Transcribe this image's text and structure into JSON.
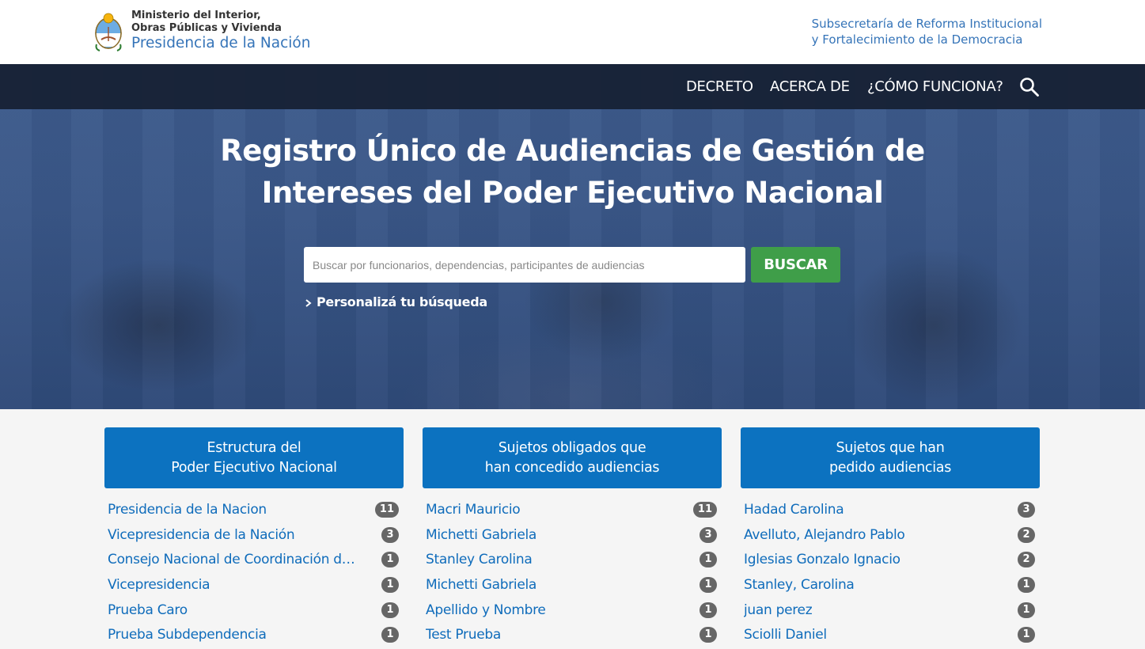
{
  "header": {
    "ministry_line1": "Ministerio del Interior,",
    "ministry_line2": "Obras Públicas y Vivienda",
    "presidency": "Presidencia de la Nación",
    "subsecretary_line1": "Subsecretaría de Reforma Institucional",
    "subsecretary_line2": "y Fortalecimiento de la Democracia"
  },
  "nav": {
    "items": [
      "DECRETO",
      "ACERCA DE",
      "¿CÓMO FUNCIONA?"
    ],
    "search_icon": "search-icon"
  },
  "hero": {
    "title_line1": "Registro Único de Audiencias de Gestión de",
    "title_line2": "Intereses del Poder Ejecutivo Nacional",
    "search_placeholder": "Buscar por funcionarios, dependencias, participantes de audiencias",
    "search_button": "BUSCAR",
    "customize_link": "Personalizá tu búsqueda"
  },
  "columns": [
    {
      "title_line1": "Estructura del",
      "title_line2": "Poder Ejecutivo Nacional",
      "items": [
        {
          "name": "Presidencia de la Nacion",
          "count": "11"
        },
        {
          "name": "Vicepresidencia de la Nación",
          "count": "3"
        },
        {
          "name": "Consejo Nacional de Coordinación de P...",
          "count": "1"
        },
        {
          "name": "Vicepresidencia",
          "count": "1"
        },
        {
          "name": "Prueba Caro",
          "count": "1"
        },
        {
          "name": "Prueba Subdependencia",
          "count": "1"
        }
      ]
    },
    {
      "title_line1": "Sujetos obligados que",
      "title_line2": "han concedido audiencias",
      "items": [
        {
          "name": "Macri Mauricio",
          "count": "11"
        },
        {
          "name": "Michetti Gabriela",
          "count": "3"
        },
        {
          "name": "Stanley Carolina",
          "count": "1"
        },
        {
          "name": "Michetti Gabriela",
          "count": "1"
        },
        {
          "name": "Apellido y Nombre",
          "count": "1"
        },
        {
          "name": "Test Prueba",
          "count": "1"
        }
      ]
    },
    {
      "title_line1": "Sujetos que han",
      "title_line2": "pedido audiencias",
      "items": [
        {
          "name": "Hadad Carolina",
          "count": "3"
        },
        {
          "name": "Avelluto, Alejandro Pablo",
          "count": "2"
        },
        {
          "name": "Iglesias Gonzalo Ignacio",
          "count": "2"
        },
        {
          "name": "Stanley, Carolina",
          "count": "1"
        },
        {
          "name": "juan perez",
          "count": "1"
        },
        {
          "name": "Sciolli Daniel",
          "count": "1"
        }
      ]
    }
  ],
  "colors": {
    "brand_blue": "#0c72c0",
    "link_blue": "#0f6cbb",
    "search_green": "#3f9e49",
    "badge_gray": "#666666",
    "navbar": "#162032"
  }
}
